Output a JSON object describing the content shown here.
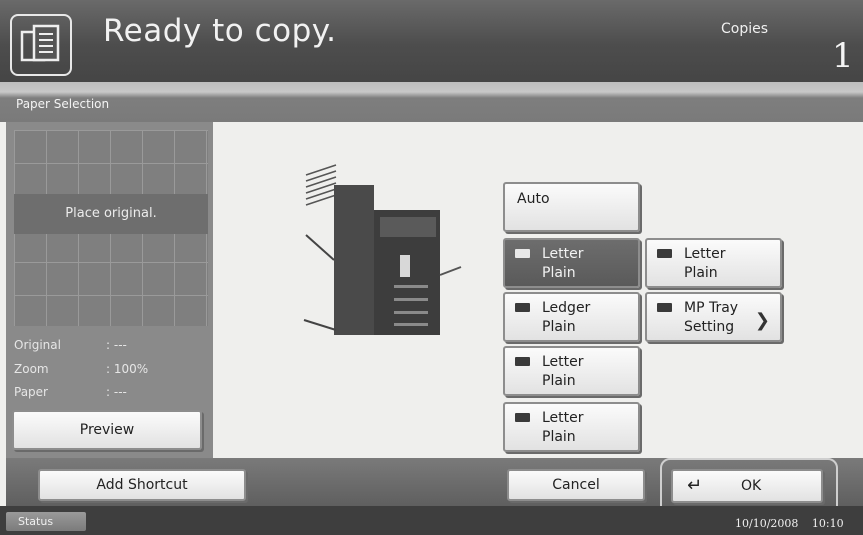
{
  "header": {
    "title": "Ready to copy.",
    "copies_label": "Copies",
    "copies_value": "1"
  },
  "section_title": "Paper Selection",
  "preview": {
    "placeholder": "Place original.",
    "original_label": "Original",
    "original_value": ": ---",
    "zoom_label": "Zoom",
    "zoom_value": ": 100%",
    "paper_label": "Paper",
    "paper_value": ": ---",
    "preview_button": "Preview"
  },
  "paper_options": {
    "auto": "Auto",
    "tray1_size": "Letter",
    "tray1_type": "Plain",
    "tray2_size": "Ledger",
    "tray2_type": "Plain",
    "tray3_size": "Letter",
    "tray3_type": "Plain",
    "tray4_size": "Letter",
    "tray4_type": "Plain",
    "cassette_size": "Letter",
    "cassette_type": "Plain",
    "mp_tray_line1": "MP Tray",
    "mp_tray_line2": "Setting",
    "selected": "tray1"
  },
  "footer": {
    "add_shortcut": "Add Shortcut",
    "cancel": "Cancel",
    "ok": "OK"
  },
  "status": {
    "label": "Status",
    "date": "10/10/2008",
    "time": "10:10"
  }
}
